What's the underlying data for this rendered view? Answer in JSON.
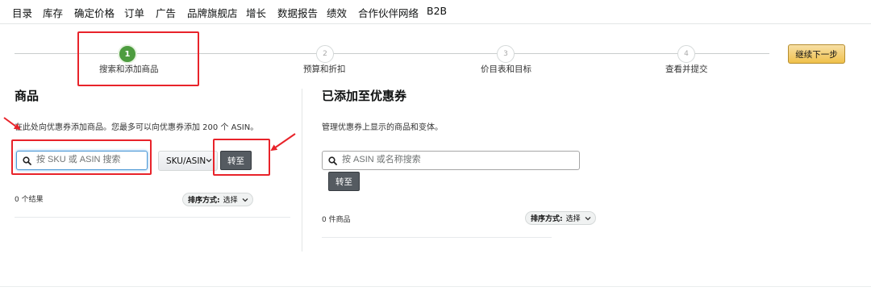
{
  "nav": {
    "items": [
      "目录",
      "库存",
      "确定价格",
      "订单",
      "广告",
      "品牌旗舰店",
      "增长",
      "数据报告",
      "绩效",
      "合作伙伴网络",
      "B2B"
    ]
  },
  "stepper": {
    "steps": [
      {
        "number": "1",
        "label": "搜索和添加商品",
        "active": true
      },
      {
        "number": "2",
        "label": "预算和折扣",
        "active": false
      },
      {
        "number": "3",
        "label": "价目表和目标",
        "active": false
      },
      {
        "number": "4",
        "label": "查看并提交",
        "active": false
      }
    ],
    "next_button": "继续下一步"
  },
  "left_panel": {
    "title": "商品",
    "description": "在此处向优惠券添加商品。您最多可以向优惠券添加 200 个 ASIN。",
    "search_placeholder": "按 SKU 或 ASIN 搜索",
    "select_value": "SKU/ASIN",
    "go_button": "转至",
    "result_count": "0 个结果",
    "sort_label": "排序方式:",
    "sort_value": "选择"
  },
  "right_panel": {
    "title": "已添加至优惠券",
    "description": "管理优惠券上显示的商品和变体。",
    "search_placeholder": "按 ASIN 或名称搜索",
    "go_button": "转至",
    "item_count": "0 件商品",
    "sort_label": "排序方式:",
    "sort_value": "选择"
  },
  "colors": {
    "active_step": "#4d9c3f",
    "annotation": "#e8232a",
    "primary_button": "#f0c14b",
    "dark_button": "#555b61"
  },
  "icons": [
    "search-icon",
    "chevron-down-icon"
  ]
}
